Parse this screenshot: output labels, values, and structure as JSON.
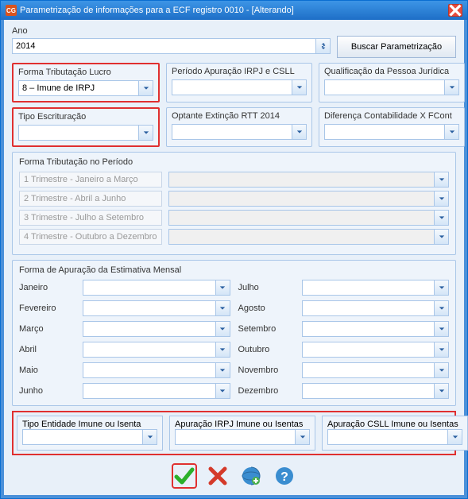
{
  "window": {
    "title": "Parametrização de informações para a ECF registro 0010 - [Alterando]",
    "app_icon": "CG"
  },
  "ano": {
    "label": "Ano",
    "value": "2014"
  },
  "buscar": {
    "label": "Buscar Parametrização"
  },
  "groups_row1": {
    "forma_trib": {
      "title": "Forma Tributação Lucro",
      "value": "8 – Imune de IRPJ"
    },
    "periodo": {
      "title": "Período Apuração IRPJ e CSLL",
      "value": ""
    },
    "qualif": {
      "title": "Qualificação da Pessoa Jurídica",
      "value": ""
    }
  },
  "groups_row2": {
    "tipo_escr": {
      "title": "Tipo Escrituração",
      "value": ""
    },
    "optante": {
      "title": "Optante Extinção RTT 2014",
      "value": ""
    },
    "dif": {
      "title": "Diferença Contabilidade X FCont",
      "value": ""
    }
  },
  "trib_periodo": {
    "legend": "Forma Tributação no Período",
    "rows": [
      {
        "label": "1 Trimestre - Janeiro a Março",
        "value": ""
      },
      {
        "label": "2 Trimestre - Abril a Junho",
        "value": ""
      },
      {
        "label": "3 Trimestre - Julho a Setembro",
        "value": ""
      },
      {
        "label": "4 Trimestre - Outubro a Dezembro",
        "value": ""
      }
    ]
  },
  "estimativa": {
    "legend": "Forma de Apuração da Estimativa Mensal",
    "left": [
      "Janeiro",
      "Fevereiro",
      "Março",
      "Abril",
      "Maio",
      "Junho"
    ],
    "right": [
      "Julho",
      "Agosto",
      "Setembro",
      "Outubro",
      "Novembro",
      "Dezembro"
    ]
  },
  "bottom": {
    "tipo_ent": {
      "title": "Tipo Entidade Imune ou Isenta",
      "value": ""
    },
    "apur_irpj": {
      "title": "Apuração IRPJ Imune ou Isentas",
      "value": ""
    },
    "apur_csll": {
      "title": "Apuração CSLL Imune ou Isentas",
      "value": ""
    }
  }
}
